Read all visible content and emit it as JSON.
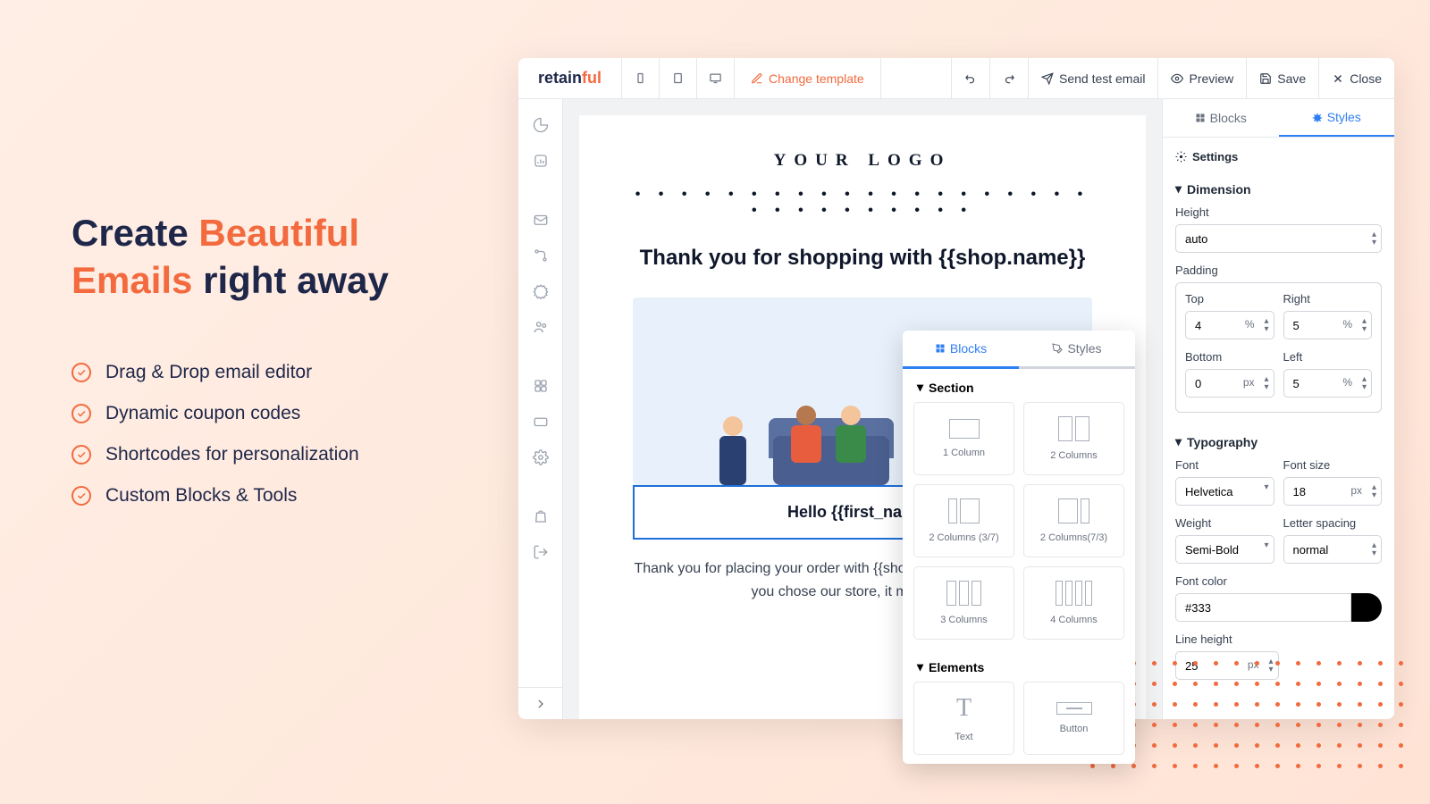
{
  "marketing": {
    "heading_1": "Create",
    "heading_2": "Beautiful Emails",
    "heading_3": "right away",
    "features": [
      "Drag & Drop email editor",
      "Dynamic coupon codes",
      "Shortcodes for personalization",
      "Custom Blocks & Tools"
    ]
  },
  "toolbar": {
    "logo_1": "retain",
    "logo_2": "ful",
    "change_template": "Change template",
    "send_test": "Send test email",
    "preview": "Preview",
    "save": "Save",
    "close": "Close"
  },
  "email": {
    "logo": "YOUR LOGO",
    "headline": "Thank you for shopping with {{shop.name}}",
    "hello": "Hello {{first_name}}",
    "body": "Thank you for placing your order with {{shop.name}}. We appreciate that you chose our store, it means a lot."
  },
  "floating_panel": {
    "tab_blocks": "Blocks",
    "tab_styles": "Styles",
    "section_title": "Section",
    "col_1": "1 Column",
    "col_2": "2 Columns",
    "col_37": "2 Columns (3/7)",
    "col_73": "2 Columns(7/3)",
    "col_3": "3 Columns",
    "col_4": "4 Columns",
    "elements_title": "Elements",
    "el_text": "Text",
    "el_button": "Button"
  },
  "styles_panel": {
    "tab_blocks": "Blocks",
    "tab_styles": "Styles",
    "settings": "Settings",
    "dimension": "Dimension",
    "height_label": "Height",
    "height_value": "auto",
    "padding_label": "Padding",
    "top_label": "Top",
    "top_value": "4",
    "top_unit": "%",
    "right_label": "Right",
    "right_value": "5",
    "right_unit": "%",
    "bottom_label": "Bottom",
    "bottom_value": "0",
    "bottom_unit": "px",
    "left_label": "Left",
    "left_value": "5",
    "left_unit": "%",
    "typography": "Typography",
    "font_label": "Font",
    "font_value": "Helvetica",
    "fontsize_label": "Font size",
    "fontsize_value": "18",
    "fontsize_unit": "px",
    "weight_label": "Weight",
    "weight_value": "Semi-Bold",
    "letterspacing_label": "Letter spacing",
    "letterspacing_value": "normal",
    "fontcolor_label": "Font color",
    "fontcolor_value": "#333",
    "lineheight_label": "Line height",
    "lineheight_value": "25",
    "lineheight_unit": "px"
  }
}
